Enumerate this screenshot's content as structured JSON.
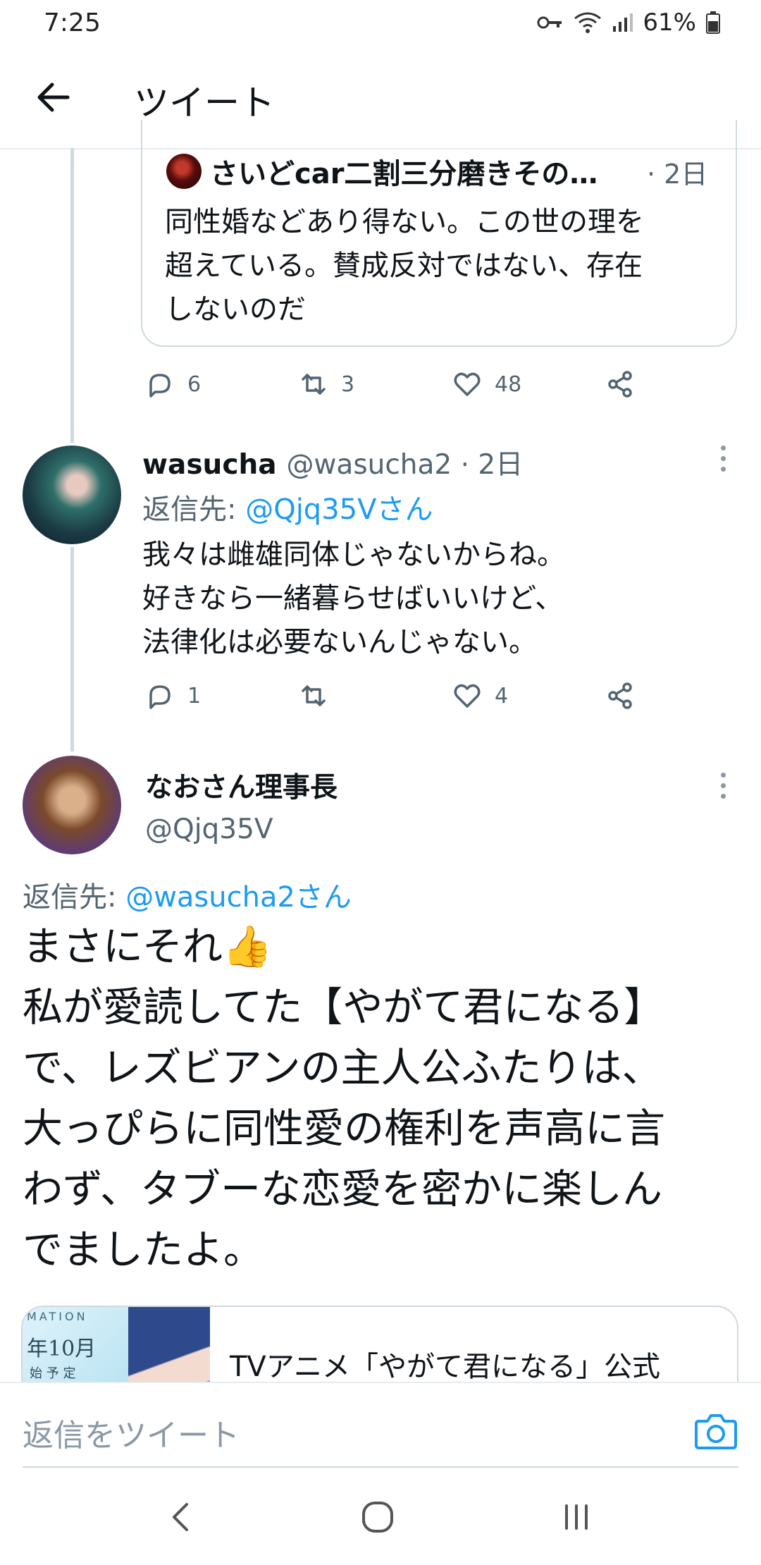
{
  "status": {
    "time": "7:25",
    "battery": "61%"
  },
  "header": {
    "title": "ツイート"
  },
  "quote": {
    "name": "さいどcar二割三分磨きその…",
    "date": "· 2日",
    "text_lines": [
      "同性婚などあり得ない。この世の理を",
      "超えている。賛成反対ではない、存在",
      "しないのだ"
    ],
    "actions": {
      "replies": "6",
      "retweets": "3",
      "likes": "48"
    }
  },
  "tweet1": {
    "name": "wasucha",
    "meta": "@wasucha2 · 2日",
    "reply_prefix": "返信先: ",
    "reply_target": "@Qjq35Vさん",
    "text_lines": [
      "我々は雌雄同体じゃないからね。",
      "好きなら一緒暮らせばいいけど、",
      "法律化は必要ないんじゃない。"
    ],
    "actions": {
      "replies": "1",
      "retweets": "",
      "likes": "4"
    }
  },
  "tweet2": {
    "name": "なおさん理事長",
    "handle": "@Qjq35V",
    "reply_prefix": "返信先: ",
    "reply_target": "@wasucha2さん",
    "text_lines": [
      "まさにそれ👍",
      "私が愛読してた【やがて君になる】",
      "で、レズビアンの主人公ふたりは、",
      "大っぴらに同性愛の権利を声高に言",
      "わず、タブーな恋愛を密かに楽しん",
      "でましたよ。"
    ]
  },
  "link_card": {
    "title": "TVアニメ「やがて君になる」公式",
    "thumb_text_1": "MATION",
    "thumb_text_2": "年10月",
    "thumb_text_3": "始 予 定"
  },
  "reply_bar": {
    "placeholder": "返信をツイート"
  },
  "icons": {
    "back": "arrow-left-icon",
    "reply": "reply-icon",
    "retweet": "retweet-icon",
    "like": "heart-icon",
    "share": "share-icon",
    "more": "more-vertical-icon",
    "camera": "camera-icon"
  },
  "colors": {
    "accent": "#1d9bf0",
    "muted": "#536471",
    "text": "#0f1419"
  }
}
